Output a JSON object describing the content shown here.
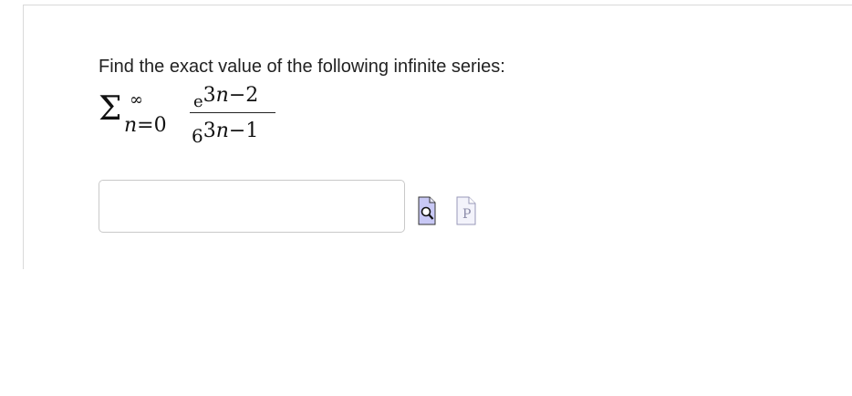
{
  "question": {
    "prompt": "Find the exact value of the following infinite series:",
    "series": {
      "sigma": "Σ",
      "upper_limit": "∞",
      "lower_var": "n",
      "lower_eq": "=0",
      "numerator_base": "e",
      "numerator_exponent_lead": "3",
      "numerator_exponent_var": "n",
      "numerator_exponent_tail": "−2",
      "denominator_base": "6",
      "denominator_exponent_lead": "3",
      "denominator_exponent_var": "n",
      "denominator_exponent_tail": "−1"
    }
  },
  "answer": {
    "value": "",
    "placeholder": ""
  },
  "tools": {
    "preview_icon": "magnifier-preview-icon",
    "syntax_icon": "syntax-help-icon",
    "preview_letter": "P",
    "accent": "#4a4ae0",
    "fill": "#c8c8f5"
  }
}
